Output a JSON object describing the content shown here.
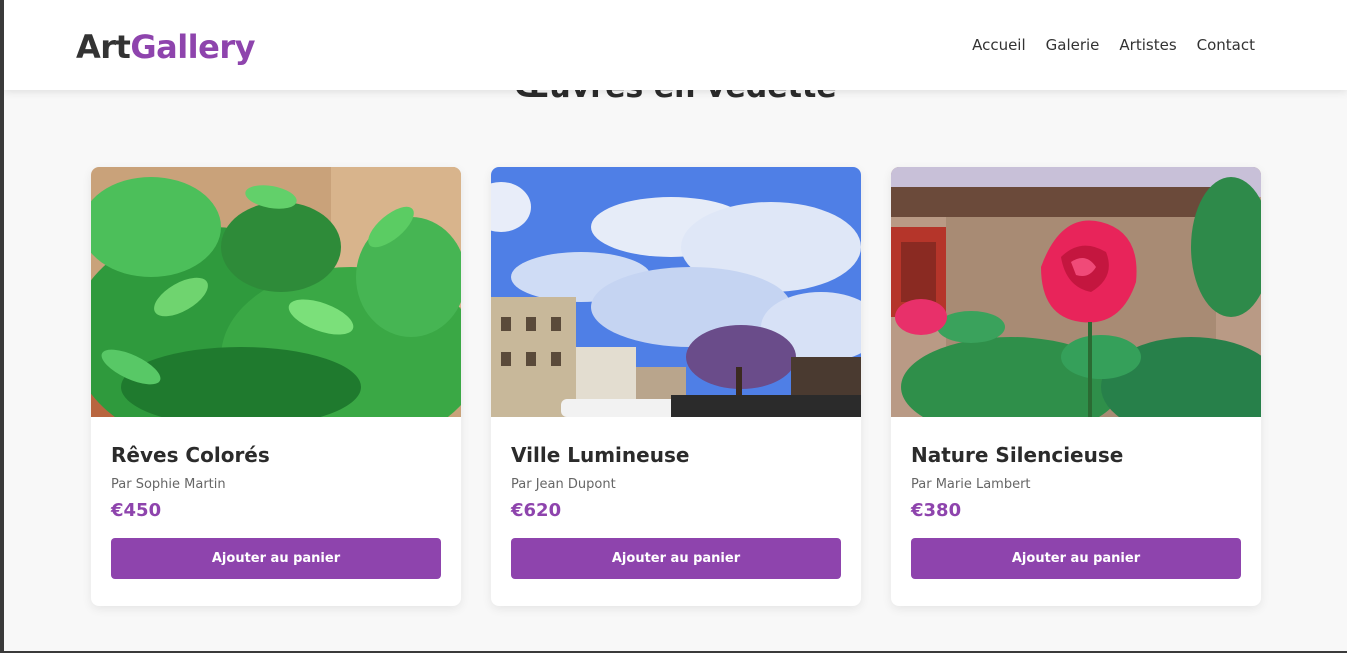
{
  "header": {
    "logo_part1": "Art",
    "logo_part2": "Gallery",
    "nav": [
      "Accueil",
      "Galerie",
      "Artistes",
      "Contact"
    ]
  },
  "section": {
    "title": "Œuvres en vedette"
  },
  "colors": {
    "accent": "#8e44ad",
    "text": "#333333",
    "muted": "#666666",
    "background": "#f8f8f8"
  },
  "artworks": [
    {
      "title": "Rêves Colorés",
      "artist": "Par Sophie Martin",
      "price": "€450",
      "button": "Ajouter au panier",
      "image": "green-plants-photo"
    },
    {
      "title": "Ville Lumineuse",
      "artist": "Par Jean Dupont",
      "price": "€620",
      "button": "Ajouter au panier",
      "image": "city-sky-photo"
    },
    {
      "title": "Nature Silencieuse",
      "artist": "Par Marie Lambert",
      "price": "€380",
      "button": "Ajouter au panier",
      "image": "red-rose-photo"
    }
  ]
}
